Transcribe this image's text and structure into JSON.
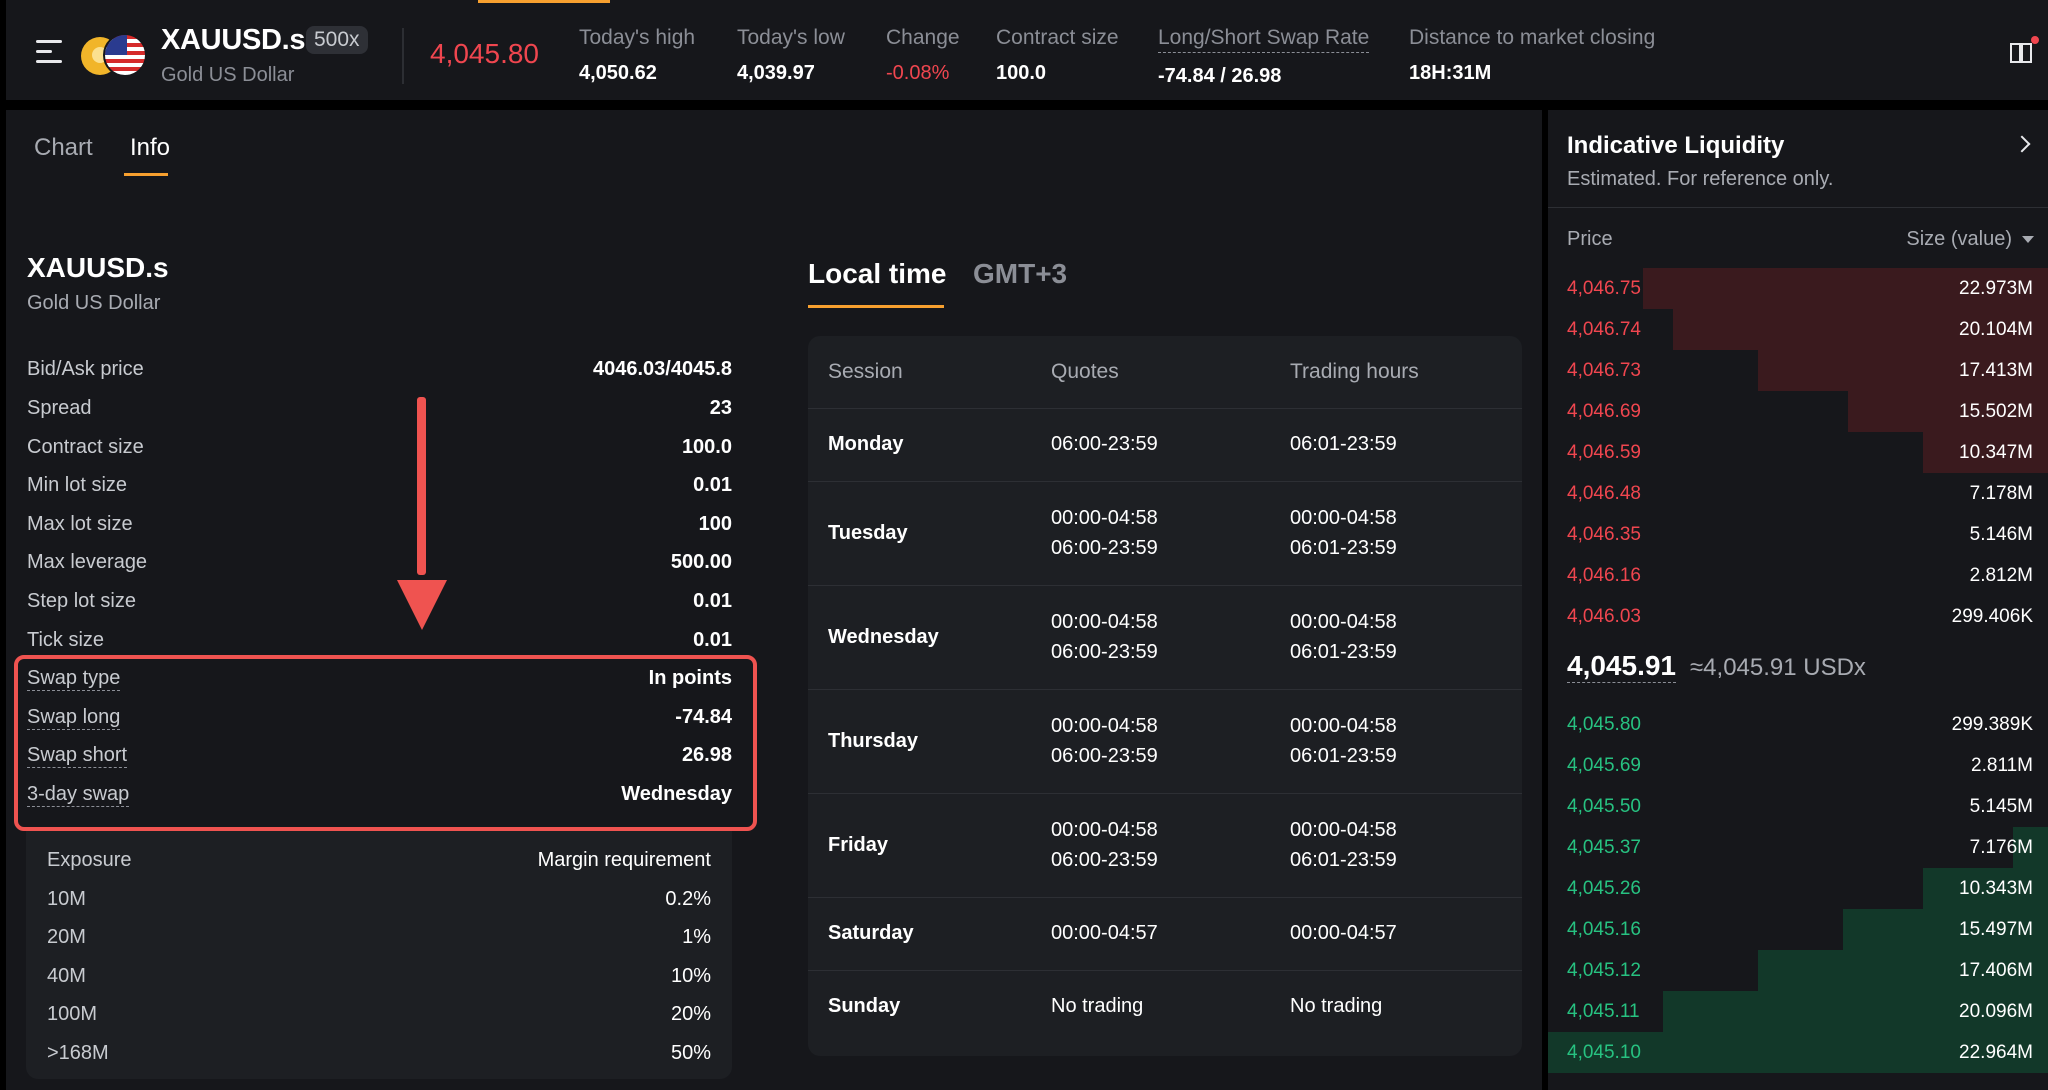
{
  "header": {
    "symbol": "XAUUSD.s",
    "leverage_badge": "500x",
    "symbol_name": "Gold US Dollar",
    "price": "4,045.80",
    "stats": [
      {
        "label": "Today's high",
        "value": "4,050.62"
      },
      {
        "label": "Today's low",
        "value": "4,039.97"
      },
      {
        "label": "Change",
        "value": "-0.08%"
      },
      {
        "label": "Contract size",
        "value": "100.0"
      },
      {
        "label": "Long/Short Swap Rate",
        "value": "-74.84 / 26.98"
      },
      {
        "label": "Distance to market closing",
        "value": "18H:31M"
      }
    ]
  },
  "tabs": [
    {
      "label": "Chart"
    },
    {
      "label": "Info"
    }
  ],
  "info": {
    "symbol": "XAUUSD.s",
    "name": "Gold US Dollar",
    "rows": [
      {
        "label": "Bid/Ask price",
        "value": "4046.03/4045.8"
      },
      {
        "label": "Spread",
        "value": "23"
      },
      {
        "label": "Contract size",
        "value": "100.0"
      },
      {
        "label": "Min lot size",
        "value": "0.01"
      },
      {
        "label": "Max lot size",
        "value": "100"
      },
      {
        "label": "Max leverage",
        "value": "500.00"
      },
      {
        "label": "Step lot size",
        "value": "0.01"
      },
      {
        "label": "Tick size",
        "value": "0.01"
      },
      {
        "label": "Swap type",
        "value": "In points"
      },
      {
        "label": "Swap long",
        "value": "-74.84"
      },
      {
        "label": "Swap short",
        "value": "26.98"
      },
      {
        "label": "3-day swap",
        "value": "Wednesday"
      }
    ],
    "margin": {
      "header": {
        "label": "Exposure",
        "value": "Margin requirement"
      },
      "rows": [
        {
          "label": "10M",
          "value": "0.2%"
        },
        {
          "label": "20M",
          "value": "1%"
        },
        {
          "label": "40M",
          "value": "10%"
        },
        {
          "label": "100M",
          "value": "20%"
        },
        {
          "label": ">168M",
          "value": "50%"
        }
      ]
    }
  },
  "sessions": {
    "time_tabs": [
      "Local time",
      "GMT+3"
    ],
    "headers": [
      "Session",
      "Quotes",
      "Trading hours"
    ],
    "rows": [
      {
        "day": "Monday",
        "quotes": [
          "06:00-23:59"
        ],
        "hours": [
          "06:01-23:59"
        ]
      },
      {
        "day": "Tuesday",
        "quotes": [
          "00:00-04:58",
          "06:00-23:59"
        ],
        "hours": [
          "00:00-04:58",
          "06:01-23:59"
        ]
      },
      {
        "day": "Wednesday",
        "quotes": [
          "00:00-04:58",
          "06:00-23:59"
        ],
        "hours": [
          "00:00-04:58",
          "06:01-23:59"
        ]
      },
      {
        "day": "Thursday",
        "quotes": [
          "00:00-04:58",
          "06:00-23:59"
        ],
        "hours": [
          "00:00-04:58",
          "06:01-23:59"
        ]
      },
      {
        "day": "Friday",
        "quotes": [
          "00:00-04:58",
          "06:00-23:59"
        ],
        "hours": [
          "00:00-04:58",
          "06:01-23:59"
        ]
      },
      {
        "day": "Saturday",
        "quotes": [
          "00:00-04:57"
        ],
        "hours": [
          "00:00-04:57"
        ]
      },
      {
        "day": "Sunday",
        "quotes": [
          "No trading"
        ],
        "hours": [
          "No trading"
        ]
      }
    ]
  },
  "liquidity": {
    "title": "Indicative Liquidity",
    "subtitle": "Estimated. For reference only.",
    "col_price": "Price",
    "col_size": "Size (value)",
    "asks": [
      {
        "price": "4,046.75",
        "size": "22.973M",
        "depth": 0.81
      },
      {
        "price": "4,046.74",
        "size": "20.104M",
        "depth": 0.75
      },
      {
        "price": "4,046.73",
        "size": "17.413M",
        "depth": 0.58
      },
      {
        "price": "4,046.69",
        "size": "15.502M",
        "depth": 0.4
      },
      {
        "price": "4,046.59",
        "size": "10.347M",
        "depth": 0.25
      },
      {
        "price": "4,046.48",
        "size": "7.178M",
        "depth": 0.0
      },
      {
        "price": "4,046.35",
        "size": "5.146M",
        "depth": 0.0
      },
      {
        "price": "4,046.16",
        "size": "2.812M",
        "depth": 0.0
      },
      {
        "price": "4,046.03",
        "size": "299.406K",
        "depth": 0.0
      }
    ],
    "mid_price": "4,045.91",
    "mid_approx": "≈4,045.91 USDx",
    "bids": [
      {
        "price": "4,045.80",
        "size": "299.389K",
        "depth": 0.0
      },
      {
        "price": "4,045.69",
        "size": "2.811M",
        "depth": 0.0
      },
      {
        "price": "4,045.50",
        "size": "5.145M",
        "depth": 0.0
      },
      {
        "price": "4,045.37",
        "size": "7.176M",
        "depth": 0.07
      },
      {
        "price": "4,045.26",
        "size": "10.343M",
        "depth": 0.25
      },
      {
        "price": "4,045.16",
        "size": "15.497M",
        "depth": 0.41
      },
      {
        "price": "4,045.12",
        "size": "17.406M",
        "depth": 0.58
      },
      {
        "price": "4,045.11",
        "size": "20.096M",
        "depth": 0.77
      },
      {
        "price": "4,045.10",
        "size": "22.964M",
        "depth": 1.0
      }
    ]
  },
  "colors": {
    "accent": "#f7a02f",
    "negative": "#f0464f",
    "positive": "#27c281",
    "annotation": "#ef5350"
  }
}
